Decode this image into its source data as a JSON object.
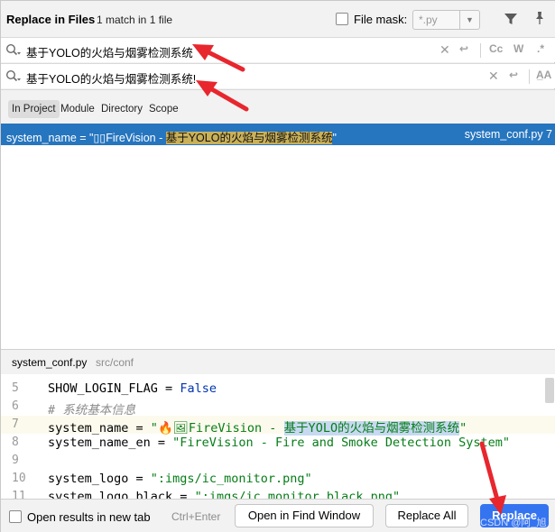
{
  "header": {
    "title": "Replace in Files",
    "subtitle": "1 match in 1 file",
    "file_mask_label": "File mask:",
    "file_mask_value": "*.py"
  },
  "search": {
    "find_text": "基于YOLO的火焰与烟雾检测系统",
    "replace_text": "基于YOLO的火焰与烟雾检测系统!",
    "toggles": [
      "Cc",
      "W",
      ".*"
    ],
    "preserve_case": "A̲A"
  },
  "scope_tabs": [
    "In Project",
    "Module",
    "Directory",
    "Scope"
  ],
  "result": {
    "prefix": "system_name = \"▯▯FireVision - ",
    "match": "基于YOLO的火焰与烟雾检测系统",
    "suffix": "\"",
    "file": "system_conf.py 7"
  },
  "preview": {
    "file": "system_conf.py",
    "path": "src/conf",
    "lines": [
      {
        "num": "5",
        "code_parts": [
          [
            "SHOW_LOGIN_FLAG = ",
            ""
          ],
          [
            "False",
            "kw"
          ]
        ]
      },
      {
        "num": "6",
        "code_parts": [
          [
            "# 系统基本信息",
            "cmt"
          ]
        ]
      },
      {
        "num": "7",
        "code_parts": [
          [
            "system_name = ",
            ""
          ],
          [
            "\"",
            "str"
          ],
          [
            "🔥🖼",
            "str"
          ],
          [
            "FireVision - ",
            "str"
          ],
          [
            "基于YOLO的火焰与烟雾检测系统",
            "str match"
          ],
          [
            "\"",
            "str"
          ]
        ]
      },
      {
        "num": "8",
        "code_parts": [
          [
            "system_name_en = ",
            ""
          ],
          [
            "\"FireVision - Fire and Smoke Detection System\"",
            "str"
          ]
        ]
      },
      {
        "num": "9",
        "code_parts": []
      },
      {
        "num": "10",
        "code_parts": [
          [
            "system_logo = ",
            ""
          ],
          [
            "\":imgs/ic_monitor.png\"",
            "str"
          ]
        ]
      },
      {
        "num": "11",
        "code_parts": [
          [
            "system_logo_black = ",
            ""
          ],
          [
            "\":imgs/ic_monitor_black.png\"",
            "str"
          ]
        ]
      }
    ]
  },
  "footer": {
    "open_results_label": "Open results in new tab",
    "shortcut": "Ctrl+Enter",
    "open_find_window": "Open in Find Window",
    "replace_all": "Replace All",
    "replace": "Replace"
  },
  "watermark": "CSDN @阿_旭"
}
